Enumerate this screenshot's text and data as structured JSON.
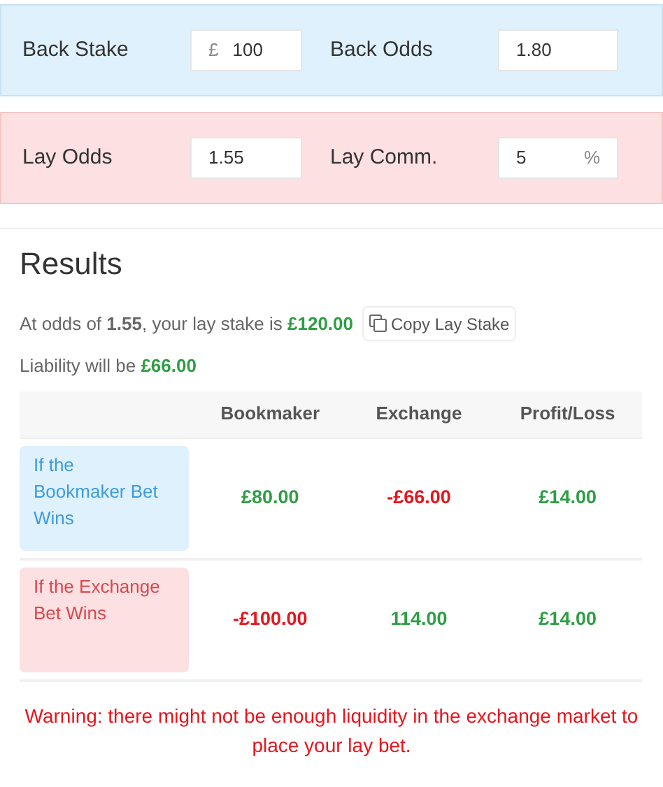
{
  "panels": [
    {
      "kind": "back",
      "fields": [
        {
          "label": "Back Stake",
          "prefix": "£",
          "value": "100"
        },
        {
          "label": "Back Odds",
          "value": "1.80"
        }
      ]
    },
    {
      "kind": "lay",
      "fields": [
        {
          "label": "Lay Odds",
          "value": "1.55"
        },
        {
          "label": "Lay Comm.",
          "value": "5",
          "suffix": "%"
        }
      ]
    }
  ],
  "results": {
    "title": "Results",
    "stake_line": {
      "text": "At odds of **1.55**, your lay stake is ",
      "amount": "£120.00"
    },
    "copy_button": "Copy Lay Stake",
    "liability_line": {
      "text": "Liability will be ",
      "amount": "£66.00"
    },
    "table": {
      "columns": [
        "Bookmaker",
        "Exchange",
        "Profit/Loss"
      ],
      "rows": [
        {
          "kind": "back",
          "label": "If the Bookmaker Bet Wins",
          "cells": [
            {
              "text": "£80.00",
              "color": "#2e9e44"
            },
            {
              "text": "-£66.00",
              "color": "#e8141c"
            },
            {
              "text": "£14.00",
              "color": "#2e9e44"
            }
          ]
        },
        {
          "kind": "lay",
          "label": "If the Exchange Bet Wins",
          "cells": [
            {
              "text": "-£100.00",
              "color": "#e8141c"
            },
            {
              "text": "114.00",
              "color": "#2e9e44"
            },
            {
              "text": "£14.00",
              "color": "#2e9e44"
            }
          ]
        }
      ]
    },
    "warning": "Warning: there might not be enough liquidity in the exchange market to place your lay bet."
  }
}
